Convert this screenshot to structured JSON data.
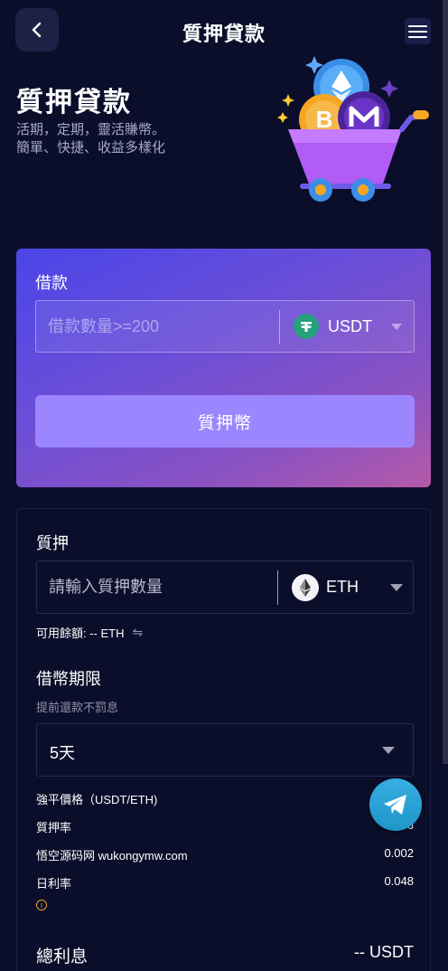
{
  "header": {
    "title": "質押貸款"
  },
  "hero": {
    "title": "質押貸款",
    "subtitle_line1": "活期，定期，靈活賺幣。",
    "subtitle_line2": "簡單、快捷、收益多樣化"
  },
  "borrow": {
    "label": "借款",
    "amount_placeholder": "借款數量>=200",
    "coin": "USDT",
    "button_label": "質押幣"
  },
  "pledge": {
    "label": "質押",
    "amount_placeholder": "請輸入質押數量",
    "coin": "ETH",
    "available_text": "可用餘額: -- ETH"
  },
  "term": {
    "label": "借幣期限",
    "hint": "提前還款不罰息",
    "selected": "5天"
  },
  "info_rows": [
    {
      "label": "強平價格（USDT/ETH)",
      "value": ""
    },
    {
      "label": "質押率",
      "value": "6"
    },
    {
      "label": "悟空源码网 wukongymw.com",
      "value": "0.002"
    },
    {
      "label": "日利率",
      "value": "0.048"
    }
  ],
  "total": {
    "label": "總利息",
    "value": "-- USDT"
  },
  "icons": {
    "back": "chevron-left-icon",
    "menu": "hamburger-menu-icon",
    "usdt": "tether-icon",
    "eth": "ethereum-icon",
    "swap": "swap-icon",
    "warning": "info-circle-icon",
    "telegram": "telegram-icon"
  },
  "colors": {
    "background": "#0b0e2a",
    "usdt_green": "#26a17b",
    "button_purple": "#9b86ff",
    "telegram_blue": "#37aee2",
    "warning_orange": "#e6a020"
  }
}
